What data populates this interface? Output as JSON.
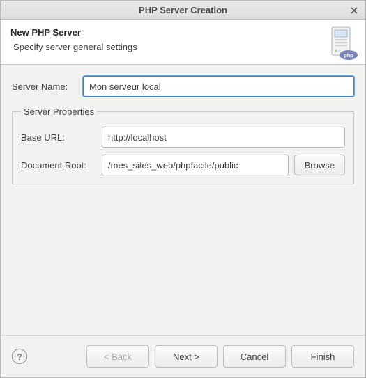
{
  "window": {
    "title": "PHP Server Creation"
  },
  "header": {
    "title": "New PHP Server",
    "subtitle": "Specify server general settings"
  },
  "icon": {
    "badge_text": "php"
  },
  "form": {
    "server_name_label": "Server Name:",
    "server_name_value": "Mon serveur local",
    "group_legend": "Server Properties",
    "base_url_label": "Base URL:",
    "base_url_value": "http://localhost",
    "doc_root_label": "Document Root:",
    "doc_root_value": "/mes_sites_web/phpfacile/public",
    "browse_label": "Browse"
  },
  "buttons": {
    "back": "< Back",
    "next": "Next >",
    "cancel": "Cancel",
    "finish": "Finish"
  }
}
